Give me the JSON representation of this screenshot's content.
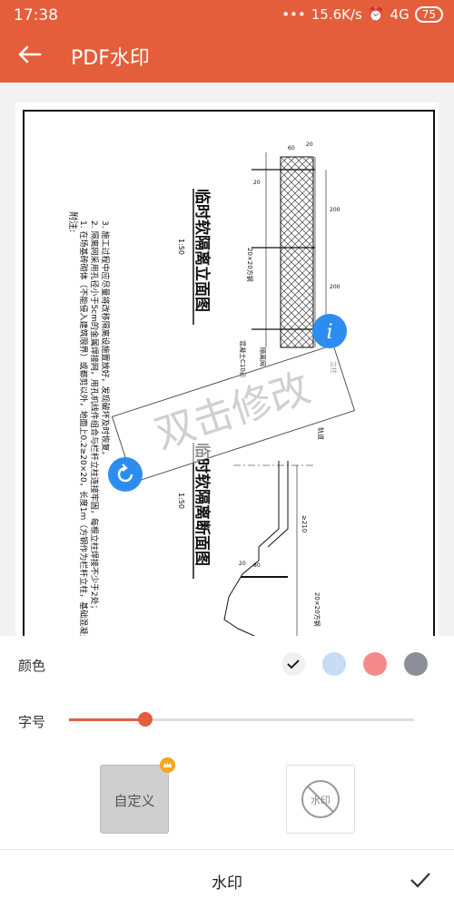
{
  "status": {
    "time": "17:38",
    "net": "15.6K/s",
    "signal": "4G",
    "battery": "75"
  },
  "header": {
    "title": "PDF水印"
  },
  "document": {
    "notes_title": "附注:",
    "notes": [
      "1. 在场基砖砌体（不能侵入建筑限界）或都剪以外，地面上0.2≥20×20，长度1m（方钢作为栏杆立柱，基础混凝土C10度；",
      "2. 隔离网采用孔径小于5cm的金属焊接网，用孔机线件组合与栏杆立柱连接牢固，每根立柱焊接不少于2处；",
      "3. 施工过程中应尽量将改移隔离设施置放好，发现破坏及时恢复。"
    ],
    "title1": "临时软隔离立面图",
    "scale1": "1:50",
    "title2": "临时软隔离断面图",
    "scale2": "1:50",
    "dims": [
      "20",
      "60",
      "20",
      "200",
      "200",
      "20×20方钢",
      "混凝土C10基",
      "隔离网",
      "20",
      "80",
      "20×20方钢",
      "≥210",
      "轨道",
      "立柱"
    ],
    "watermark": "双击修改"
  },
  "panel": {
    "color_label": "颜色",
    "colors": [
      "#f0f0f0",
      "#c7dcf5",
      "#f58a8a",
      "#8d8f98"
    ],
    "selected_color": 0,
    "size_label": "字号",
    "size_value": 0.22,
    "custom_label": "自定义",
    "none_label": "水印"
  },
  "bottom": {
    "tab": "水印"
  }
}
